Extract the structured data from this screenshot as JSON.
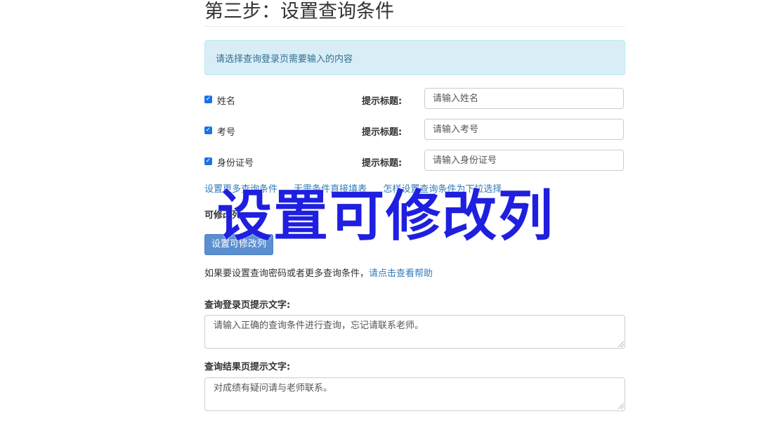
{
  "page": {
    "title": "第三步：设置查询条件",
    "info_text": "请选择查询登录页需要输入的内容"
  },
  "fields": [
    {
      "label": "姓名",
      "checked": true,
      "prompt_label": "提示标题:",
      "placeholder": "请输入姓名"
    },
    {
      "label": "考号",
      "checked": true,
      "prompt_label": "提示标题:",
      "placeholder": "请输入考号"
    },
    {
      "label": "身份证号",
      "checked": true,
      "prompt_label": "提示标题:",
      "placeholder": "请输入身份证号"
    }
  ],
  "links": {
    "more_conditions": "设置更多查询条件",
    "no_condition": "无需条件直接填表",
    "dropdown_help": "怎样设置查询条件为下拉选择"
  },
  "editable": {
    "label": "可修改列:",
    "button": "设置可修改列"
  },
  "help": {
    "text": "如果要设置查询密码或者更多查询条件，",
    "link": "请点击查看帮助"
  },
  "login_tip": {
    "label": "查询登录页提示文字:",
    "value": "请输入正确的查询条件进行查询，忘记请联系老师。"
  },
  "result_tip": {
    "label": "查询结果页提示文字:",
    "value": "对成绩有疑问请与老师联系。"
  },
  "overlay": {
    "caption": "设置可修改列",
    "color": "#1f1fe0"
  },
  "colors": {
    "link": "#337ab7",
    "info_bg": "#d9edf7",
    "button": "#5b8fd0"
  }
}
